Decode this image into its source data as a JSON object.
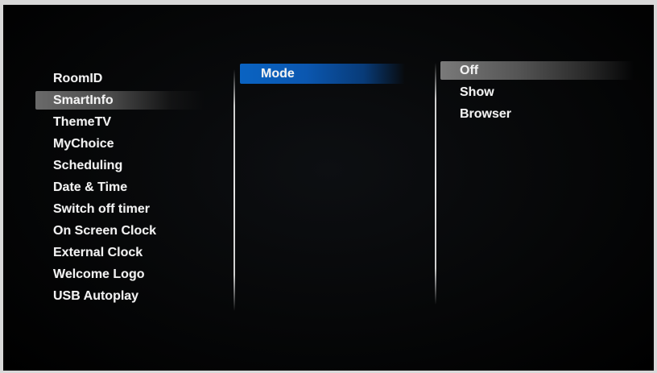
{
  "menu": {
    "left": [
      {
        "label": "RoomID"
      },
      {
        "label": "SmartInfo",
        "selected": true
      },
      {
        "label": "ThemeTV"
      },
      {
        "label": "MyChoice"
      },
      {
        "label": "Scheduling"
      },
      {
        "label": "Date & Time"
      },
      {
        "label": "Switch off timer"
      },
      {
        "label": "On Screen Clock"
      },
      {
        "label": "External Clock"
      },
      {
        "label": "Welcome Logo"
      },
      {
        "label": "USB Autoplay"
      }
    ],
    "middle": [
      {
        "label": "Mode",
        "focused": true
      }
    ],
    "right": [
      {
        "label": "Off",
        "selected": true
      },
      {
        "label": "Show"
      },
      {
        "label": "Browser"
      }
    ]
  },
  "colors": {
    "focus_blue": "#0a63c2",
    "selection_gray": "#6a6a6a",
    "text": "#f2f2f2",
    "background": "#000000"
  }
}
